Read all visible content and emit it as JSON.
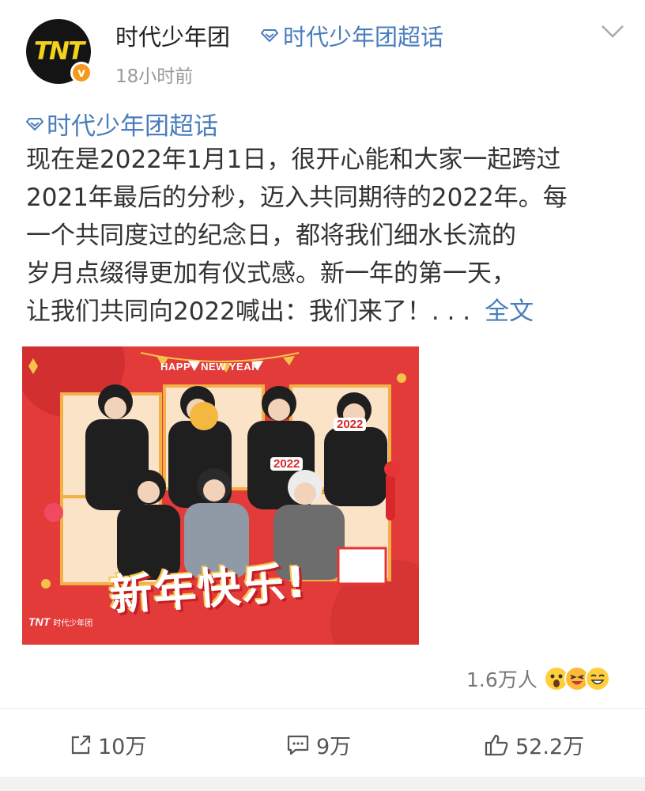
{
  "post": {
    "author": "时代少年团",
    "avatar_text": "TNT",
    "verified_badge": "v",
    "topic_inline": "时代少年团超话",
    "time": "18小时前",
    "topic_tag": "时代少年团超话",
    "body_lines": [
      "现在是2022年1月1日，很开心能和大家一起跨过",
      "2021年最后的分秒，迈入共同期待的2022年。每",
      "一个共同度过的纪念日，都将我们细水长流的",
      "岁月点缀得更加有仪式感。新一年的第一天，",
      "让我们共同向2022喊出：我们来了！. . ."
    ],
    "full_text_link": "全文",
    "image": {
      "header_text": "HAPPY NEW YEAR",
      "year_tag_1": "2022",
      "year_tag_2": "2022",
      "greeting": "新年快乐!",
      "brand_small": "时代少年团",
      "brand_logo": "TNT"
    },
    "likers_count": "1.6万人",
    "reaction_icons": [
      "shocked-emoji-icon",
      "laughing-emoji-icon",
      "grinning-emoji-icon"
    ]
  },
  "actions": {
    "share_label": "10万",
    "comment_label": "9万",
    "like_label": "52.2万"
  },
  "colors": {
    "link": "#4a7dbd",
    "badge": "#f39a1e",
    "poster_red": "#e23b3a",
    "avatar_bg": "#141414",
    "avatar_logo": "#f2d21c"
  }
}
